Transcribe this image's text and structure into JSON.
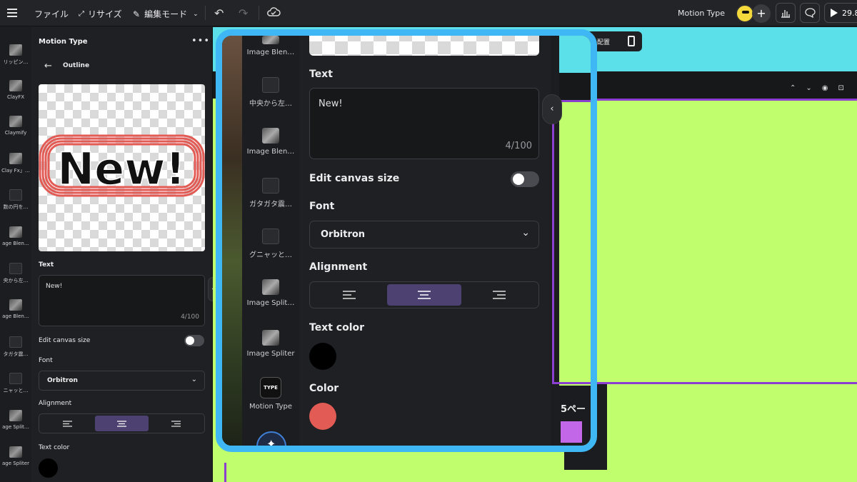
{
  "topbar": {
    "file": "ファイル",
    "resize": "リサイズ",
    "edit_mode": "編集モード",
    "project_title": "Motion Type",
    "play_time": "29.8"
  },
  "rail": {
    "items": [
      "リッピン…",
      "ClayFX",
      "Claymify",
      "Clay Fx」…",
      "数の円を…",
      "age Blen…",
      "央から左…",
      "age Blen…",
      "タガタ震…",
      "ニャッと…",
      "age Split…",
      "age Spliter"
    ]
  },
  "panel": {
    "title": "Motion Type",
    "sub_title": "Outline",
    "preview_text": "New!",
    "text_label": "Text",
    "text_value": "New!",
    "text_count": "4/100",
    "canvas_label": "Edit canvas size",
    "font_label": "Font",
    "font_value": "Orbitron",
    "alignment_label": "Alignment",
    "text_color_label": "Text color"
  },
  "canvas": {
    "toolbar_label": "配置",
    "page_label": "5ペー"
  },
  "zoom": {
    "rail_items": [
      "Image Blen…",
      "中央から左…",
      "Image Blen…",
      "ガタガタ震…",
      "グニャッと…",
      "Image Split…",
      "Image Spliter",
      "Motion Type"
    ],
    "motion_type_badge": "TYPE",
    "text_label": "Text",
    "text_value": "New!",
    "text_count": "4/100",
    "canvas_label": "Edit canvas size",
    "font_label": "Font",
    "font_value": "Orbitron",
    "alignment_label": "Alignment",
    "text_color_label": "Text color",
    "color_label": "Color",
    "text_color": "#000000",
    "color": "#e35b55"
  },
  "colors": {
    "accent_highlight": "#3eb7f4",
    "canvas_green": "#c1fe6e",
    "canvas_cyan": "#5bdfe8",
    "selection_purple": "#8a3fd1",
    "align_active": "#4d4171"
  }
}
